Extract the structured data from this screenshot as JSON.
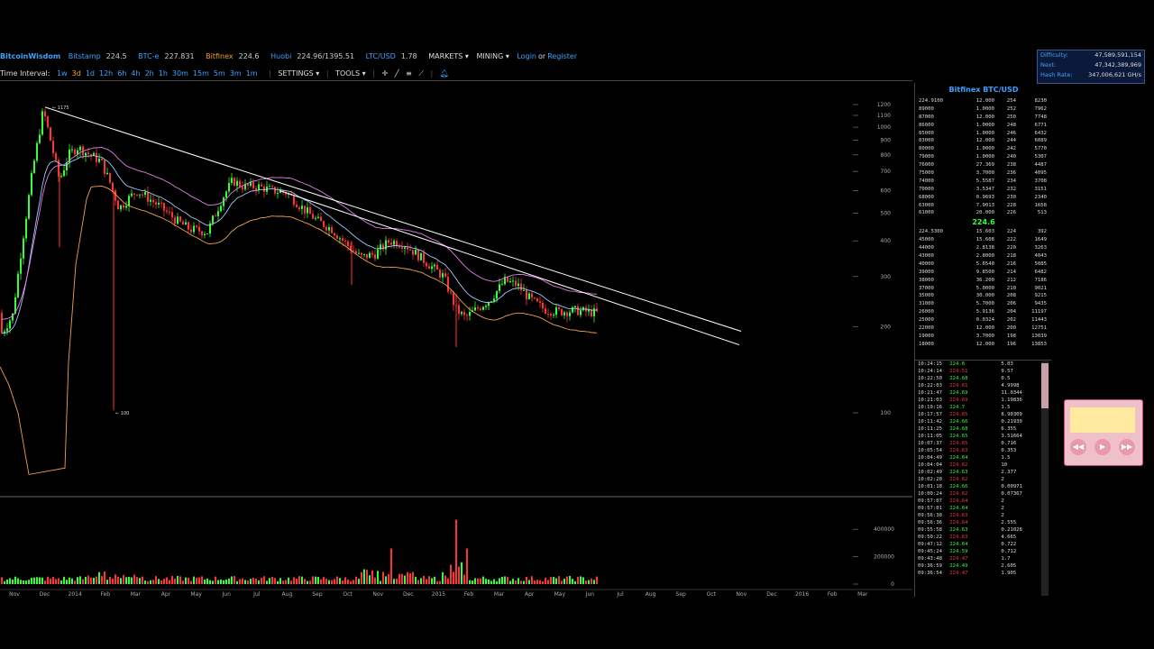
{
  "topbar": {
    "brand": "BitcoinWisdom",
    "exchanges": [
      {
        "name": "Bitstamp",
        "value": "224.5",
        "cls": "ex"
      },
      {
        "name": "BTC-e",
        "value": "227.831",
        "cls": "ex"
      },
      {
        "name": "Bitfinex",
        "value": "224.6",
        "cls": "bfx"
      },
      {
        "name": "Huobi",
        "value": "224.96/1395.51",
        "cls": "ex"
      },
      {
        "name": "LTC/USD",
        "value": "1.78",
        "cls": "ex"
      }
    ],
    "markets": "MARKETS ▾",
    "mining": "MINING ▾",
    "login": "Login",
    "or": "or",
    "register": "Register"
  },
  "difficulty": {
    "rows": [
      {
        "k": "Difficulty:",
        "v": "47,589,591,154"
      },
      {
        "k": "Next:",
        "v": "47,342,389,969"
      },
      {
        "k": "Hash Rate:",
        "v": "347,006,621 GH/s"
      }
    ]
  },
  "toolbar": {
    "time_interval": "Time Interval:",
    "intervals": [
      "1w",
      "3d",
      "1d",
      "12h",
      "6h",
      "4h",
      "2h",
      "1h",
      "30m",
      "15m",
      "5m",
      "3m",
      "1m"
    ],
    "active_interval": "3d",
    "settings": "SETTINGS ▾",
    "tools": "TOOLS ▾"
  },
  "chart_data": {
    "type": "candlestick",
    "title": "",
    "price_ticks": [
      "1200",
      "1100",
      "1000",
      "900",
      "800",
      "700",
      "600",
      "500",
      "400",
      "300",
      "200",
      "100"
    ],
    "price_tick_values": [
      1200,
      1100,
      1000,
      900,
      800,
      700,
      600,
      500,
      400,
      300,
      200,
      100
    ],
    "x_ticks": [
      "Nov",
      "Dec",
      "2014",
      "Feb",
      "Mar",
      "Apr",
      "May",
      "Jun",
      "Jul",
      "Aug",
      "Sep",
      "Oct",
      "Nov",
      "Dec",
      "2015",
      "Feb",
      "Mar",
      "Apr",
      "May",
      "Jun",
      "Jul",
      "Aug",
      "Sep",
      "Oct",
      "Nov",
      "Dec",
      "2016",
      "Feb",
      "Mar"
    ],
    "volume_ticks": [
      "400000",
      "200000",
      "0"
    ],
    "volume_tick_values": [
      400000,
      200000,
      0
    ],
    "annotations": [
      {
        "text": "1175",
        "value": 1175
      },
      {
        "text": "100",
        "value": 100
      }
    ],
    "ylim": [
      100,
      1200
    ],
    "yscale": "log",
    "volume_ylim": [
      0,
      500000
    ],
    "grid": false
  },
  "orderbook": {
    "title": "Bitfinex BTC/USD",
    "asks": [
      [
        "224.9100",
        "12.000",
        "254",
        "8230"
      ],
      [
        "89000",
        "1.0000",
        "252",
        "7962"
      ],
      [
        "87000",
        "12.000",
        "250",
        "7748"
      ],
      [
        "86000",
        "1.0000",
        "248",
        "6771"
      ],
      [
        "85000",
        "1.0000",
        "246",
        "6432"
      ],
      [
        "83000",
        "12.000",
        "244",
        "6089"
      ],
      [
        "80000",
        "1.0000",
        "242",
        "5770"
      ],
      [
        "79000",
        "1.0000",
        "240",
        "5307"
      ],
      [
        "76000",
        "27.369",
        "238",
        "4487"
      ],
      [
        "75000",
        "3.7000",
        "236",
        "4095"
      ],
      [
        "74000",
        "5.5587",
        "234",
        "3708"
      ],
      [
        "70000",
        "3.5347",
        "232",
        "3151"
      ],
      [
        "68000",
        "0.9693",
        "230",
        "2340"
      ],
      [
        "63000",
        "7.9013",
        "228",
        "1658"
      ],
      [
        "61000",
        "20.000",
        "226",
        "513"
      ]
    ],
    "mid_price": "224.6",
    "bids": [
      [
        "224.5300",
        "15.603",
        "224",
        "392"
      ],
      [
        "45000",
        "15.608",
        "222",
        "1649"
      ],
      [
        "44000",
        "2.8138",
        "220",
        "3263"
      ],
      [
        "43000",
        "2.8000",
        "218",
        "4043"
      ],
      [
        "40000",
        "5.6540",
        "216",
        "5085"
      ],
      [
        "39000",
        "9.8500",
        "214",
        "6482"
      ],
      [
        "38000",
        "36.200",
        "212",
        "7186"
      ],
      [
        "37000",
        "5.0000",
        "210",
        "9021"
      ],
      [
        "35000",
        "30.000",
        "208",
        "9215"
      ],
      [
        "31000",
        "5.7000",
        "206",
        "9435"
      ],
      [
        "26000",
        "5.9136",
        "204",
        "11197"
      ],
      [
        "25000",
        "0.0324",
        "202",
        "11443"
      ],
      [
        "22000",
        "12.000",
        "200",
        "12751"
      ],
      [
        "19000",
        "3.7000",
        "198",
        "13039"
      ],
      [
        "18000",
        "12.000",
        "196",
        "13853"
      ]
    ]
  },
  "trades": [
    [
      "10:24:15",
      "224.6",
      "up",
      "5.03"
    ],
    [
      "10:24:14",
      "224.51",
      "dn",
      "9.57"
    ],
    [
      "10:22:50",
      "224.68",
      "up",
      "0.5"
    ],
    [
      "10:22:03",
      "224.61",
      "dn",
      "4.9998"
    ],
    [
      "10:21:47",
      "224.69",
      "up",
      "11.0344"
    ],
    [
      "10:21:03",
      "224.69",
      "dn",
      "1.19836"
    ],
    [
      "10:19:16",
      "224.7",
      "up",
      "1.5"
    ],
    [
      "10:17:57",
      "224.65",
      "dn",
      "8.90309"
    ],
    [
      "10:11:42",
      "224.66",
      "up",
      "0.21930"
    ],
    [
      "10:11:25",
      "224.68",
      "up",
      "6.355"
    ],
    [
      "10:11:05",
      "224.65",
      "up",
      "3.51664"
    ],
    [
      "10:07:37",
      "224.65",
      "dn",
      "0.716"
    ],
    [
      "10:05:54",
      "224.63",
      "dn",
      "0.353"
    ],
    [
      "10:04:49",
      "224.64",
      "up",
      "1.5"
    ],
    [
      "10:04:04",
      "224.62",
      "dn",
      "10"
    ],
    [
      "10:02:49",
      "224.63",
      "up",
      "2.377"
    ],
    [
      "10:02:28",
      "224.62",
      "dn",
      "2"
    ],
    [
      "10:01:18",
      "224.66",
      "up",
      "0.00971"
    ],
    [
      "10:00:24",
      "224.62",
      "dn",
      "0.07367"
    ],
    [
      "09:57:07",
      "224.64",
      "dn",
      "2"
    ],
    [
      "09:57:01",
      "224.64",
      "up",
      "2"
    ],
    [
      "09:56:38",
      "224.63",
      "dn",
      "2"
    ],
    [
      "09:56:36",
      "224.64",
      "dn",
      "2.555"
    ],
    [
      "09:55:58",
      "224.63",
      "up",
      "0.21028"
    ],
    [
      "09:50:22",
      "224.63",
      "dn",
      "4.665"
    ],
    [
      "09:47:12",
      "224.64",
      "up",
      "0.722"
    ],
    [
      "09:45:24",
      "224.59",
      "up",
      "0.712"
    ],
    [
      "09:43:48",
      "224.47",
      "dn",
      "1.7"
    ],
    [
      "09:36:59",
      "224.49",
      "up",
      "2.605"
    ],
    [
      "09:36:54",
      "224.47",
      "dn",
      "1.905"
    ]
  ],
  "colors": {
    "up": "#33ff33",
    "down": "#ff3333",
    "ema_blue": "#9fc8ff",
    "ema_pink": "#e080e8",
    "ema_orange": "#f0a050",
    "trend": "#ffffff"
  }
}
